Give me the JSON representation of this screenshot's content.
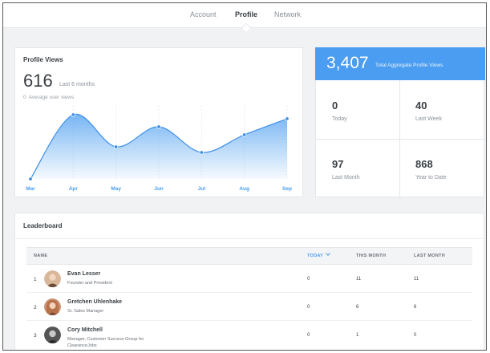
{
  "nav": {
    "tabs": [
      {
        "label": "Account"
      },
      {
        "label": "Profile"
      },
      {
        "label": "Network"
      }
    ]
  },
  "profile_views": {
    "title": "Profile Views",
    "count": "616",
    "range": "Last 6 months",
    "average_value": "0",
    "average_label": "Average user views"
  },
  "chart_data": {
    "type": "area",
    "categories": [
      "Mar",
      "Apr",
      "May",
      "Jun",
      "Jul",
      "Aug",
      "Sep"
    ],
    "series": [
      {
        "values": [
          0,
          80,
          40,
          65,
          33,
          55,
          75
        ]
      }
    ],
    "ylim": [
      0,
      100
    ],
    "grid": "vertical",
    "color": "#4a9df0"
  },
  "stats": {
    "total": "3,407",
    "total_label": "Total Aggregate Profile Views",
    "today": {
      "value": "0",
      "label": "Today"
    },
    "last_week": {
      "value": "40",
      "label": "Last Week"
    },
    "last_month": {
      "value": "97",
      "label": "Last Month"
    },
    "year_to_date": {
      "value": "868",
      "label": "Year to Date"
    }
  },
  "leaderboard": {
    "title": "Leaderboard",
    "columns": {
      "name": "NAME",
      "today": "TODAY",
      "this_month": "THIS MONTH",
      "last_month": "LAST MONTH"
    },
    "rows": [
      {
        "rank": "1",
        "name": "Evan Lesser",
        "role": "Founder and President",
        "today": "0",
        "this_month": "11",
        "last_month": "11"
      },
      {
        "rank": "2",
        "name": "Gretchen Uhlenhake",
        "role": "Sr. Sales Manager",
        "today": "0",
        "this_month": "6",
        "last_month": "6"
      },
      {
        "rank": "3",
        "name": "Cory Mitchell",
        "role": "Manager, Customer Success Group for ClearanceJobs",
        "today": "0",
        "this_month": "1",
        "last_month": "0"
      }
    ]
  },
  "colors": {
    "accent": "#4a9df0",
    "text": "#3a3f44",
    "muted": "#8a9098"
  }
}
